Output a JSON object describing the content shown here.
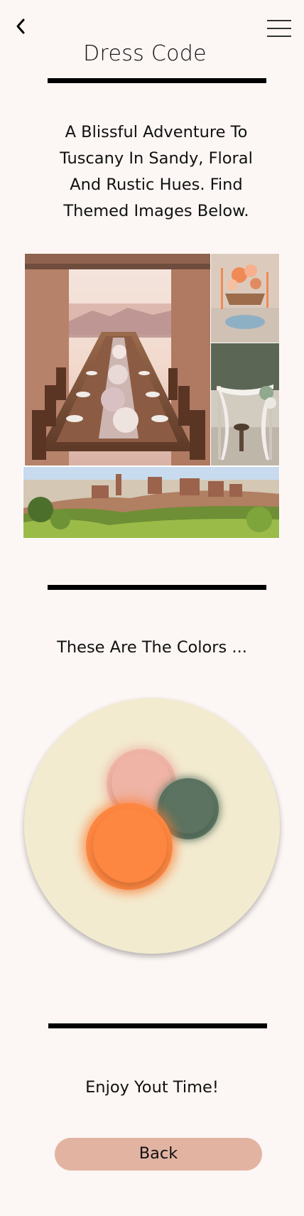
{
  "header": {
    "back_icon": "chevron-left-icon",
    "menu_icon": "hamburger-menu-icon",
    "title": "Dress Code"
  },
  "intro": {
    "text": "A Blissful Adventure To Tuscany In Sandy, Floral And Rustic Hues. Find Themed Images Below."
  },
  "gallery": {
    "images": [
      {
        "name": "tuscan-table-photo",
        "subject": "long dinner table under pergola"
      },
      {
        "name": "centerpiece-photo",
        "subject": "table setting with peach flowers"
      },
      {
        "name": "floral-arch-photo",
        "subject": "draped arch with greenery"
      },
      {
        "name": "hilltop-village-photo",
        "subject": "tuscan hillside village"
      }
    ]
  },
  "colors": {
    "heading": "These Are The Colors ...",
    "palette": [
      {
        "name": "sand",
        "hex": "#f3ebd0"
      },
      {
        "name": "blush",
        "hex": "#efb4a5"
      },
      {
        "name": "sage",
        "hex": "#5b7360"
      },
      {
        "name": "orange",
        "hex": "#fd8640"
      }
    ]
  },
  "footer": {
    "closing": "Enjoy Yout Time!",
    "back_label": "Back",
    "button_color": "#e3b3a2"
  }
}
